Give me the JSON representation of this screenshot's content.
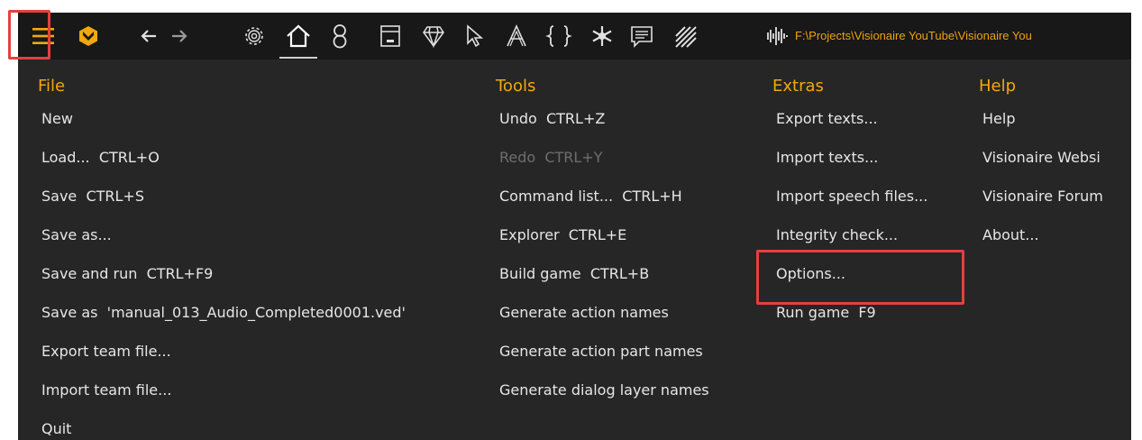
{
  "colors": {
    "background": "#262626",
    "toolbar": "#181818",
    "accent": "#f2a80e",
    "text": "#e6e6e6",
    "disabled": "#6e6e6e",
    "highlight": "#e34040"
  },
  "toolbar": {
    "icons": [
      "hamburger-menu-icon",
      "visionaire-logo-icon",
      "back-arrow-icon",
      "forward-arrow-icon",
      "gear-icon",
      "home-icon",
      "characters-icon",
      "interfaces-icon",
      "gem-icon",
      "cursor-icon",
      "font-icon",
      "script-braces-icon",
      "particles-icon",
      "dialogs-icon",
      "hatch-icon",
      "audio-waveform-icon"
    ],
    "path": "F:\\Projects\\Visionaire YouTube\\Visionaire You"
  },
  "menus": {
    "file": {
      "title": "File",
      "items": [
        {
          "label": "New"
        },
        {
          "label": "Load...  CTRL+O"
        },
        {
          "label": "Save  CTRL+S"
        },
        {
          "label": "Save as..."
        },
        {
          "label": "Save and run  CTRL+F9"
        },
        {
          "label": "Save as  'manual_013_Audio_Completed0001.ved'"
        },
        {
          "label": "Export team file..."
        },
        {
          "label": "Import team file..."
        },
        {
          "label": "Quit"
        }
      ]
    },
    "tools": {
      "title": "Tools",
      "items": [
        {
          "label": "Undo  CTRL+Z"
        },
        {
          "label": "Redo  CTRL+Y",
          "disabled": true
        },
        {
          "label": "Command list...  CTRL+H"
        },
        {
          "label": "Explorer  CTRL+E"
        },
        {
          "label": "Build game  CTRL+B"
        },
        {
          "label": "Generate action names"
        },
        {
          "label": "Generate action part names"
        },
        {
          "label": "Generate dialog layer names"
        }
      ]
    },
    "extras": {
      "title": "Extras",
      "items": [
        {
          "label": "Export texts..."
        },
        {
          "label": "Import texts..."
        },
        {
          "label": "Import speech files..."
        },
        {
          "label": "Integrity check..."
        },
        {
          "label": "Options..."
        },
        {
          "label": "Run game  F9"
        }
      ]
    },
    "help": {
      "title": "Help",
      "items": [
        {
          "label": "Help"
        },
        {
          "label": "Visionaire Websi"
        },
        {
          "label": "Visionaire Forum"
        },
        {
          "label": "About..."
        }
      ]
    }
  }
}
